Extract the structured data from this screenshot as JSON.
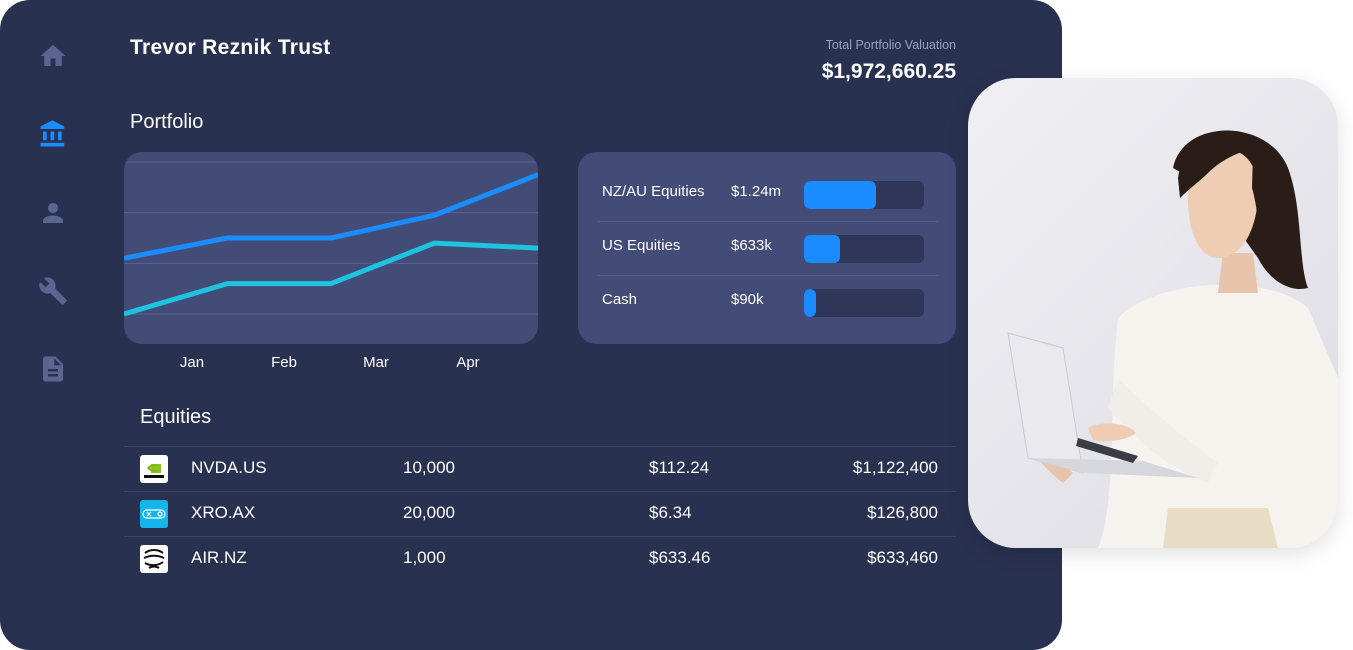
{
  "header": {
    "title": "Trevor Reznik Trust",
    "total_label": "Total Portfolio Valuation",
    "total_value": "$1,972,660.25"
  },
  "sidebar": {
    "items": [
      {
        "icon": "home-icon",
        "active": false
      },
      {
        "icon": "bank-icon",
        "active": true
      },
      {
        "icon": "person-icon",
        "active": false
      },
      {
        "icon": "wrench-icon",
        "active": false
      },
      {
        "icon": "document-icon",
        "active": false
      }
    ]
  },
  "portfolio": {
    "title": "Portfolio",
    "allocations": [
      {
        "name": "NZ/AU Equities",
        "amount": "$1.24m",
        "fill": 0.6
      },
      {
        "name": "US Equities",
        "amount": "$633k",
        "fill": 0.3
      },
      {
        "name": "Cash",
        "amount": "$90k",
        "fill": 0.1
      }
    ]
  },
  "chart_data": {
    "type": "line",
    "categories": [
      "Jan",
      "Feb",
      "Mar",
      "Apr"
    ],
    "series": [
      {
        "values": [
          2.2,
          3.0,
          3.0,
          3.9,
          5.5
        ],
        "color": "#1a8cff"
      },
      {
        "values": [
          0.0,
          1.2,
          1.2,
          2.8,
          2.6
        ],
        "color": "#1ec3e0"
      }
    ],
    "x": [
      0,
      1,
      2,
      3,
      4
    ],
    "grid": true
  },
  "equities": {
    "title": "Equities",
    "rows": [
      {
        "logo": "nvidia-logo",
        "ticker": "NVDA.US",
        "qty": "10,000",
        "price": "$112.24",
        "value": "$1,122,400"
      },
      {
        "logo": "xero-logo",
        "ticker": "XRO.AX",
        "qty": "20,000",
        "price": "$6.34",
        "value": "$126,800"
      },
      {
        "logo": "air-nz-logo",
        "ticker": "AIR.NZ",
        "qty": "1,000",
        "price": "$633.46",
        "value": "$633,460"
      }
    ]
  },
  "colors": {
    "background": "#293150",
    "card": "#434b77",
    "accent": "#1a8cff",
    "accent2": "#1ec3e0",
    "nav_inactive": "#5b6690"
  }
}
